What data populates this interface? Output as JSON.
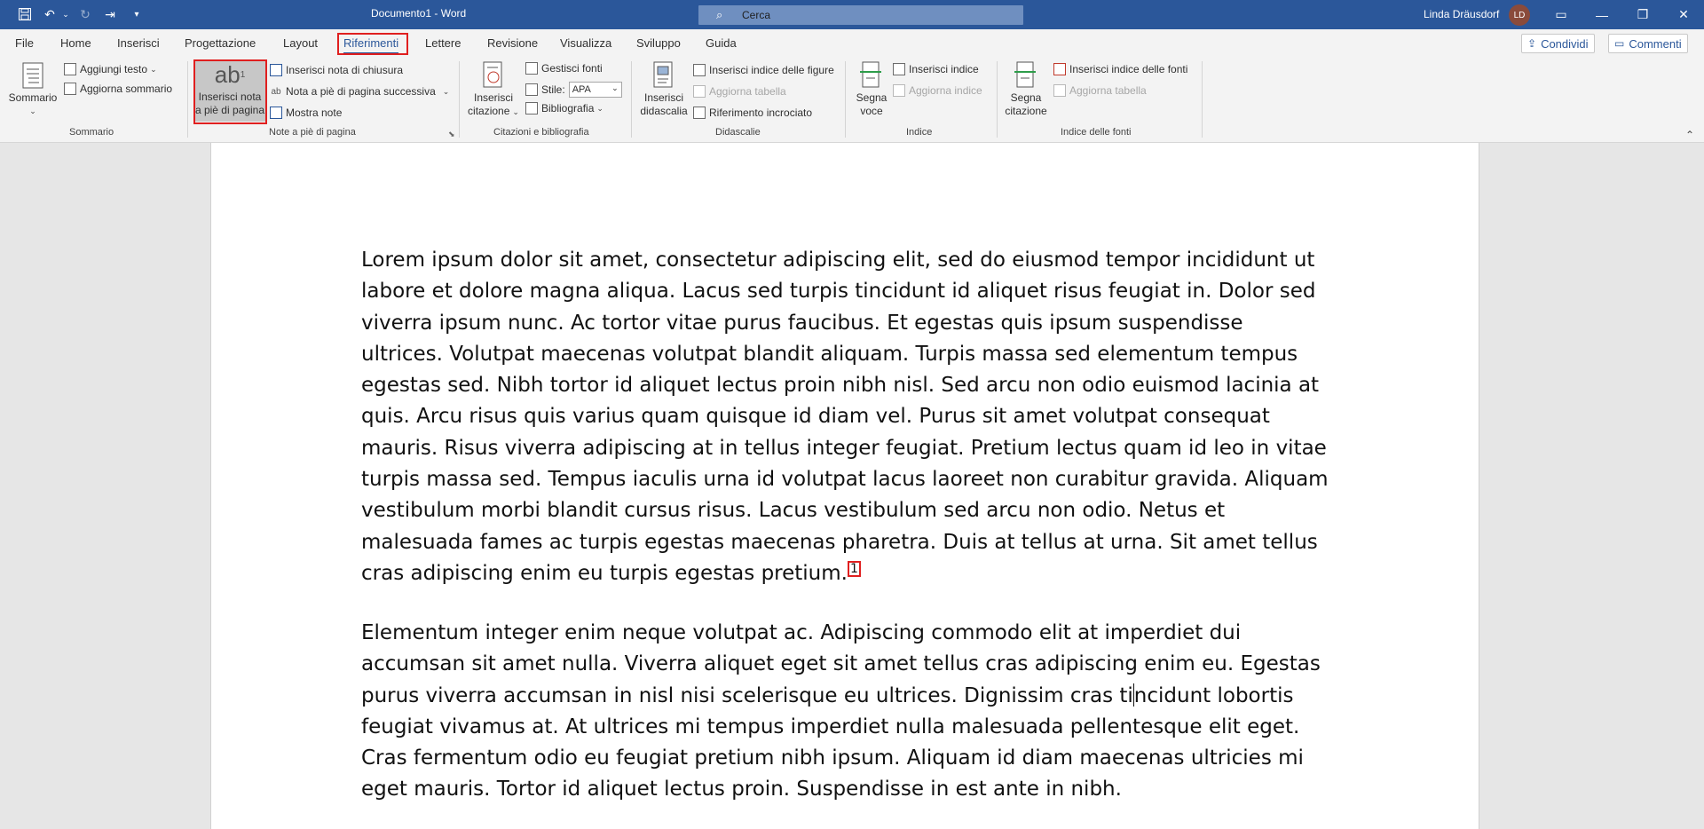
{
  "title_bar": {
    "document_title": "Documento1  -  Word",
    "search_placeholder": "Cerca",
    "user_name": "Linda Dräusdorf",
    "user_initials": "LD"
  },
  "tabs": [
    "File",
    "Home",
    "Inserisci",
    "Progettazione",
    "Layout",
    "Riferimenti",
    "Lettere",
    "Revisione",
    "Visualizza",
    "Sviluppo",
    "Guida"
  ],
  "active_tab": "Riferimenti",
  "actions": {
    "share": "Condividi",
    "comments": "Commenti"
  },
  "ribbon": {
    "sommario": {
      "label": "Sommario",
      "big_button": "Sommario",
      "aggiungi_testo": "Aggiungi testo",
      "aggiorna_sommario": "Aggiorna sommario"
    },
    "note": {
      "label": "Note a piè di pagina",
      "insert_footnote_line1": "Inserisci nota",
      "insert_footnote_line2": "a piè di pagina",
      "insert_endnote": "Inserisci nota di chiusura",
      "next_footnote": "Nota a piè di pagina successiva",
      "show_notes": "Mostra note"
    },
    "citazioni": {
      "label": "Citazioni e bibliografia",
      "insert_citation_line1": "Inserisci",
      "insert_citation_line2": "citazione",
      "manage_sources": "Gestisci fonti",
      "style_label": "Stile:",
      "style_value": "APA",
      "bibliography": "Bibliografia"
    },
    "didascalie": {
      "label": "Didascalie",
      "insert_caption_line1": "Inserisci",
      "insert_caption_line2": "didascalia",
      "insert_table_of_figures": "Inserisci indice delle figure",
      "update_table": "Aggiorna tabella",
      "cross_reference": "Riferimento incrociato"
    },
    "indice": {
      "label": "Indice",
      "mark_entry_line1": "Segna",
      "mark_entry_line2": "voce",
      "insert_index": "Inserisci indice",
      "update_index": "Aggiorna indice"
    },
    "indice_fonti": {
      "label": "Indice delle fonti",
      "mark_citation_line1": "Segna",
      "mark_citation_line2": "citazione",
      "insert_table_of_authorities": "Inserisci indice delle fonti",
      "update_table": "Aggiorna tabella"
    }
  },
  "document": {
    "paragraph1": "Lorem ipsum dolor sit amet, consectetur adipiscing elit, sed do eiusmod tempor incididunt ut labore et dolore magna aliqua. Lacus sed turpis tincidunt id aliquet risus feugiat in. Dolor sed viverra ipsum nunc. Ac tortor vitae purus faucibus. Et egestas quis ipsum suspendisse ultrices. Volutpat maecenas volutpat blandit aliquam. Turpis massa sed elementum tempus egestas sed. Nibh tortor id aliquet lectus proin nibh nisl. Sed arcu non odio euismod lacinia at quis. Arcu risus quis varius quam quisque id diam vel. Purus sit amet volutpat consequat mauris. Risus viverra adipiscing at in tellus integer feugiat. Pretium lectus quam id leo in vitae turpis massa sed. Tempus iaculis urna id volutpat lacus laoreet non curabitur gravida. Aliquam vestibulum morbi blandit cursus risus. Lacus vestibulum sed arcu non odio. Netus et malesuada fames ac turpis egestas maecenas pharetra. Duis at tellus at urna. Sit amet tellus cras adipiscing enim eu turpis egestas pretium.",
    "footnote_ref": "1",
    "paragraph2_before_cursor": "Elementum integer enim neque volutpat ac. Adipiscing commodo elit at imperdiet dui accumsan sit amet nulla. Viverra aliquet eget sit amet tellus cras adipiscing enim eu. Egestas purus viverra accumsan in nisl nisi scelerisque eu ultrices. Dignissim cras ti",
    "paragraph2_after_cursor": "ncidunt lobortis feugiat vivamus at. At ultrices mi tempus imperdiet nulla malesuada pellentesque elit eget. Cras fermentum odio eu feugiat pretium nibh ipsum. Aliquam id diam maecenas ultricies mi eget mauris. Tortor id aliquet lectus proin. Suspendisse in est ante in nibh."
  }
}
